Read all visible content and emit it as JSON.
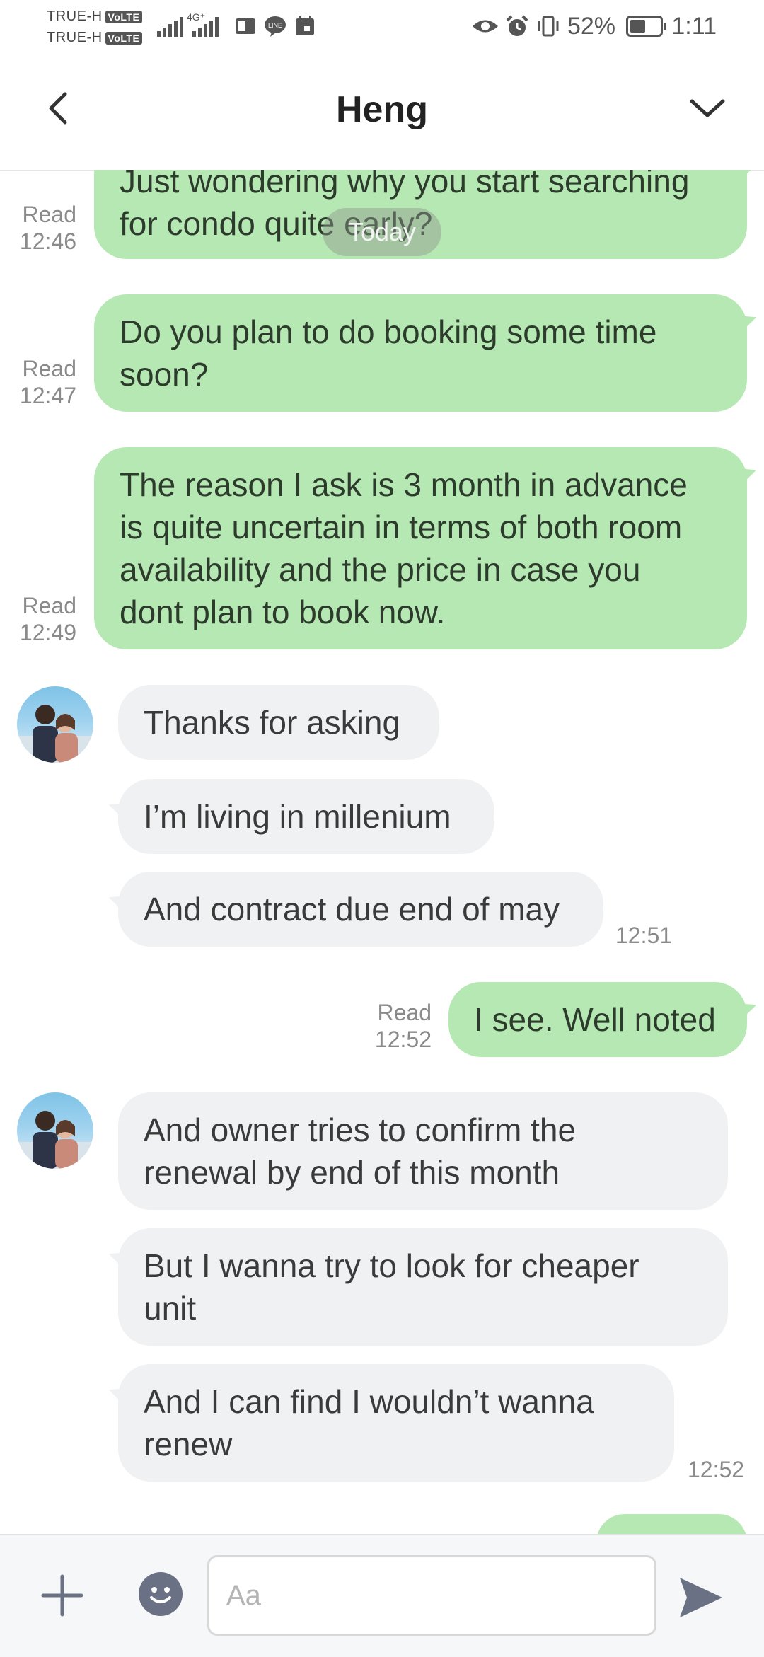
{
  "status_bar": {
    "carrier_1": "TRUE-H",
    "carrier_2": "TRUE-H",
    "volte": "VoLTE",
    "network": "4G⁺",
    "battery_percent": "52%",
    "battery_level": 0.52,
    "time": "1:11"
  },
  "header": {
    "title": "Heng"
  },
  "chat": {
    "date_separator": "Today",
    "messages": [
      {
        "dir": "out",
        "text": "Just wondering why you start searching\nfor condo quite early?",
        "read": "Read",
        "time": "12:46"
      },
      {
        "dir": "out",
        "text": "Do you plan to do booking some time\nsoon?",
        "read": "Read",
        "time": "12:47"
      },
      {
        "dir": "out",
        "text": "The reason I ask is 3 month in advance\nis quite uncertain in terms of both room\navailability and the price in case you\ndont plan to book now.",
        "read": "Read",
        "time": "12:49"
      },
      {
        "dir": "in",
        "text": "Thanks for asking"
      },
      {
        "dir": "in",
        "text": "I’m living in millenium"
      },
      {
        "dir": "in",
        "text": "And contract due end of may",
        "time": "12:51"
      },
      {
        "dir": "out",
        "text": "I see. Well noted",
        "read": "Read",
        "time": "12:52"
      },
      {
        "dir": "in",
        "text": "And owner tries to confirm the\nrenewal by end of this month"
      },
      {
        "dir": "in",
        "text": "But I wanna try to look for cheaper\nunit"
      },
      {
        "dir": "in",
        "text": "And I can find I wouldn’t wanna\nrenew",
        "time": "12:52"
      }
    ]
  },
  "input": {
    "placeholder": "Aa"
  }
}
